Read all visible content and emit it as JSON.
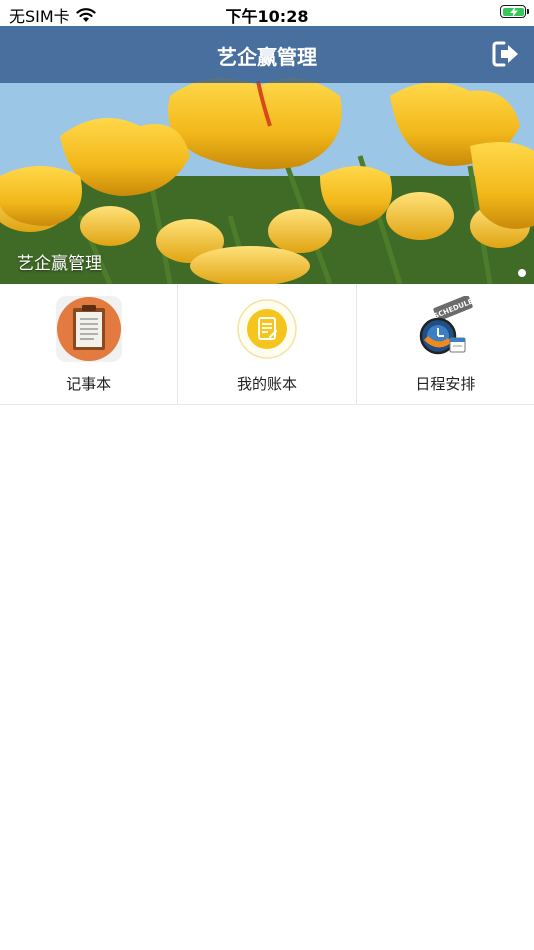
{
  "status_bar": {
    "carrier": "无SIM卡",
    "time": "下午10:28",
    "battery_color": "#34c759"
  },
  "nav": {
    "title": "艺企赢管理",
    "background": "#365c8c",
    "logout_icon": "logout-icon"
  },
  "banner": {
    "caption": "艺企赢管理",
    "image": "yellow-tulips-field",
    "page_index": 1,
    "page_count": 1
  },
  "features": [
    {
      "label": "记事本",
      "icon": "clipboard-notepad-icon"
    },
    {
      "label": "我的账本",
      "icon": "ledger-note-icon"
    },
    {
      "label": "日程安排",
      "icon": "schedule-clock-icon"
    }
  ]
}
